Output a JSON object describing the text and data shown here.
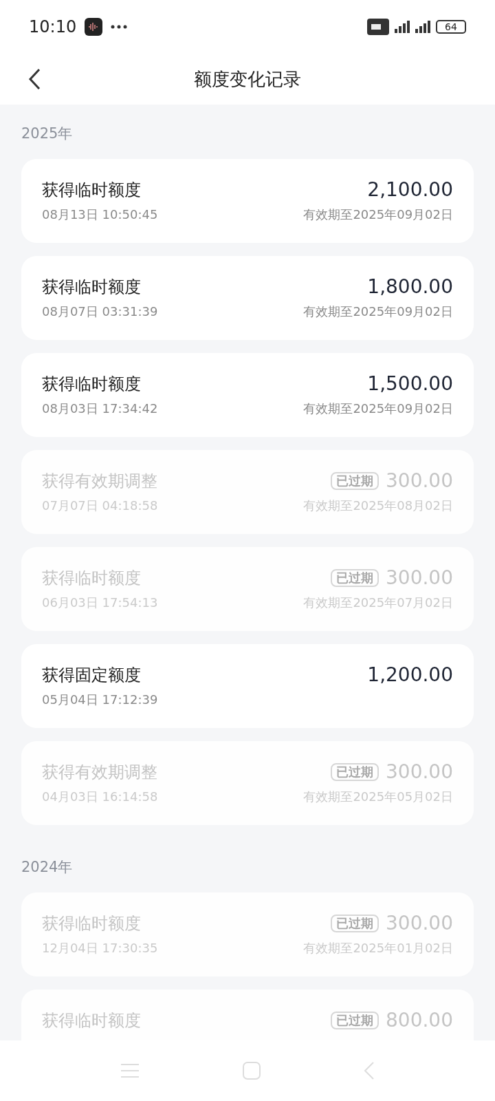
{
  "status_bar": {
    "time": "10:10",
    "battery": "64"
  },
  "header": {
    "title": "额度变化记录"
  },
  "sections": [
    {
      "year": "2025年",
      "records": [
        {
          "title": "获得临时额度",
          "time": "08月13日 10:50:45",
          "amount": "2,100.00",
          "validity": "有效期至2025年09月02日",
          "expired": false
        },
        {
          "title": "获得临时额度",
          "time": "08月07日 03:31:39",
          "amount": "1,800.00",
          "validity": "有效期至2025年09月02日",
          "expired": false
        },
        {
          "title": "获得临时额度",
          "time": "08月03日 17:34:42",
          "amount": "1,500.00",
          "validity": "有效期至2025年09月02日",
          "expired": false
        },
        {
          "title": "获得有效期调整",
          "time": "07月07日 04:18:58",
          "amount": "300.00",
          "validity": "有效期至2025年08月02日",
          "expired": true,
          "stamp": "已过期"
        },
        {
          "title": "获得临时额度",
          "time": "06月03日 17:54:13",
          "amount": "300.00",
          "validity": "有效期至2025年07月02日",
          "expired": true,
          "stamp": "已过期"
        },
        {
          "title": "获得固定额度",
          "time": "05月04日 17:12:39",
          "amount": "1,200.00",
          "expired": false
        },
        {
          "title": "获得有效期调整",
          "time": "04月03日 16:14:58",
          "amount": "300.00",
          "validity": "有效期至2025年05月02日",
          "expired": true,
          "stamp": "已过期"
        }
      ]
    },
    {
      "year": "2024年",
      "records": [
        {
          "title": "获得临时额度",
          "time": "12月04日 17:30:35",
          "amount": "300.00",
          "validity": "有效期至2025年01月02日",
          "expired": true,
          "stamp": "已过期"
        },
        {
          "title": "获得临时额度",
          "amount": "800.00",
          "expired": true,
          "stamp": "已过期"
        }
      ]
    }
  ]
}
